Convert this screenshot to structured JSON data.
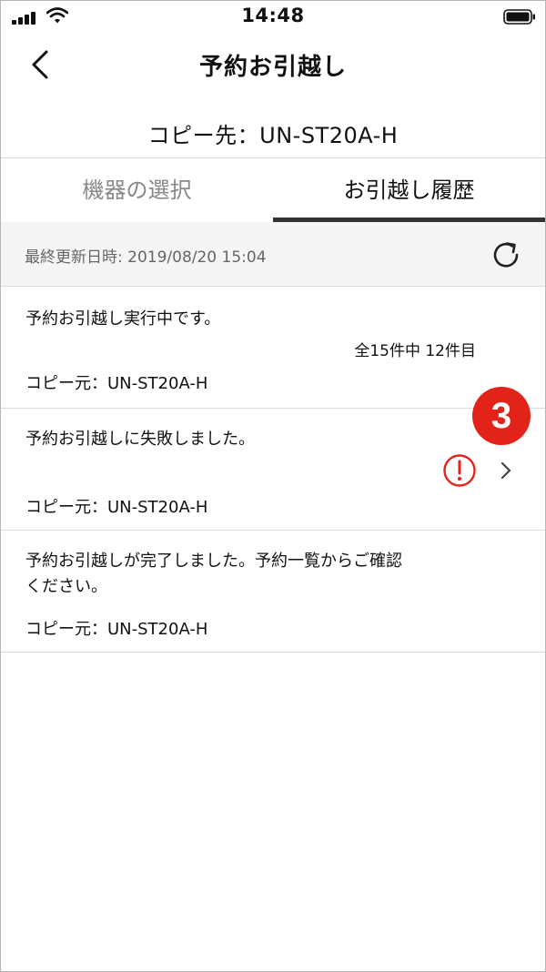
{
  "status_bar": {
    "time": "14:48",
    "signal_icon": "signal-bars-icon",
    "wifi_icon": "wifi-icon",
    "battery_icon": "battery-icon"
  },
  "header": {
    "title": "予約お引越し",
    "back_icon": "chevron-left-icon"
  },
  "copy_destination": {
    "label": "コピー先：",
    "value": "UN-ST20A-H"
  },
  "tabs": [
    {
      "label": "機器の選択",
      "active": false
    },
    {
      "label": "お引越し履歴",
      "active": true
    }
  ],
  "update": {
    "text": "最終更新日時: 2019/08/20 15:04",
    "refresh_icon": "refresh-icon"
  },
  "history": [
    {
      "message": "予約お引越し実行中です。",
      "progress": "全15件中 12件目",
      "source_label": "コピー元：",
      "source_value": "UN-ST20A-H"
    },
    {
      "message": "予約お引越しに失敗しました。",
      "status_icon": "error-exclamation-icon",
      "detail_icon": "chevron-right-icon",
      "source_label": "コピー元：",
      "source_value": "UN-ST20A-H"
    },
    {
      "message": "予約お引越しが完了しました。予約一覧からご確認ください。",
      "source_label": "コピー元：",
      "source_value": "UN-ST20A-H"
    }
  ],
  "annotation_badge": "3",
  "colors": {
    "error": "#e2231a",
    "tab_underline": "#333333",
    "inactive_tab": "#888888"
  }
}
